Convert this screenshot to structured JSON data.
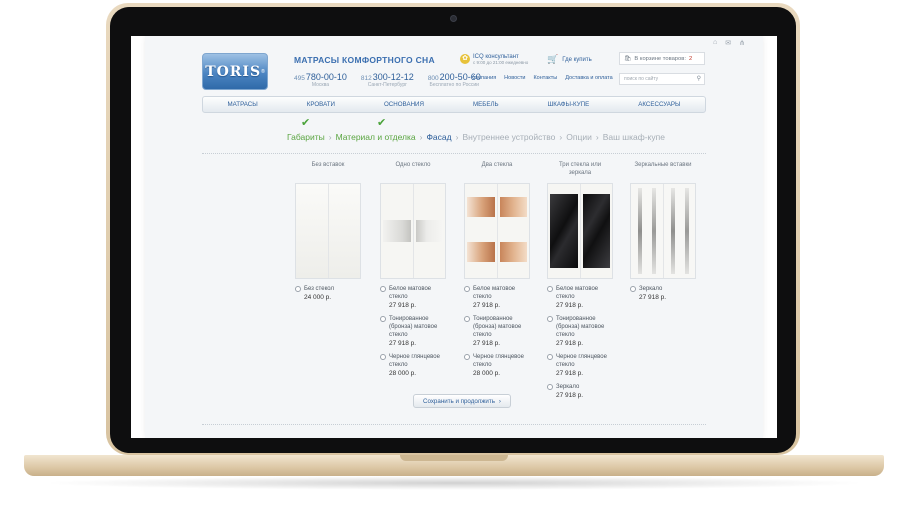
{
  "header": {
    "brand_title": "МАТРАСЫ КОМФОРТНОГО СНА",
    "logo_text": "TORIS",
    "logo_mark": "®",
    "phones": [
      {
        "code": "495",
        "number": "780-00-10",
        "city": "Москва"
      },
      {
        "code": "812",
        "number": "300-12-12",
        "city": "Санкт-Петербург"
      },
      {
        "code": "800",
        "number": "200-50-60",
        "city": "Бесплатно по России"
      }
    ],
    "consultant": {
      "title": "ICQ консультант",
      "hours": "с 9:00 до 21:00 ежедневно"
    },
    "where_to_buy": "Где купить",
    "cart": {
      "label": "В корзине товаров:",
      "count": "2"
    },
    "subnav": [
      "Компания",
      "Новости",
      "Контакты",
      "Доставка и оплата"
    ],
    "search_placeholder": "поиск по сайту",
    "top_icons": [
      "home-icon",
      "mail-icon",
      "sitemap-icon"
    ]
  },
  "mainnav": [
    "МАТРАСЫ",
    "КРОВАТИ",
    "ОСНОВАНИЯ",
    "МЕБЕЛЬ",
    "ШКАФЫ-КУПЕ",
    "АКСЕССУАРЫ"
  ],
  "steps": [
    {
      "label": "Габариты",
      "state": "done"
    },
    {
      "label": "Материал и отделка",
      "state": "done"
    },
    {
      "label": "Фасад",
      "state": "active"
    },
    {
      "label": "Внутреннее устройство",
      "state": "todo"
    },
    {
      "label": "Опции",
      "state": "todo"
    },
    {
      "label": "Ваш шкаф-купе",
      "state": "todo"
    }
  ],
  "step_separator": "›",
  "columns": [
    {
      "title": "Без вставок",
      "options": [
        {
          "label": "Без стекол",
          "price": "24 000 р."
        }
      ]
    },
    {
      "title": "Одно стекло",
      "options": [
        {
          "label": "Белое матовое стекло",
          "price": "27 918 р."
        },
        {
          "label": "Тонированное (бронза) матовое стекло",
          "price": "27 918 р."
        },
        {
          "label": "Черное глянцевое стекло",
          "price": "28 000 р."
        }
      ]
    },
    {
      "title": "Два стекла",
      "options": [
        {
          "label": "Белое матовое стекло",
          "price": "27 918 р."
        },
        {
          "label": "Тонированное (бронза) матовое стекло",
          "price": "27 918 р."
        },
        {
          "label": "Черное глянцевое стекло",
          "price": "28 000 р."
        }
      ]
    },
    {
      "title": "Три стекла или зеркала",
      "options": [
        {
          "label": "Белое матовое стекло",
          "price": "27 918 р."
        },
        {
          "label": "Тонированное (бронза) матовое стекло",
          "price": "27 918 р."
        },
        {
          "label": "Черное глянцевое стекло",
          "price": "27 918 р."
        },
        {
          "label": "Зеркало",
          "price": "27 918 р."
        }
      ]
    },
    {
      "title": "Зеркальные вставки",
      "options": [
        {
          "label": "Зеркало",
          "price": "27 918 р."
        }
      ]
    }
  ],
  "save_button": "Сохранить и продолжить",
  "save_arrow": "›",
  "colors": {
    "accent": "#2e5f9a",
    "done": "#5aa541",
    "bronze": "#c98a5c",
    "black_glass": "#1c1c1e"
  }
}
